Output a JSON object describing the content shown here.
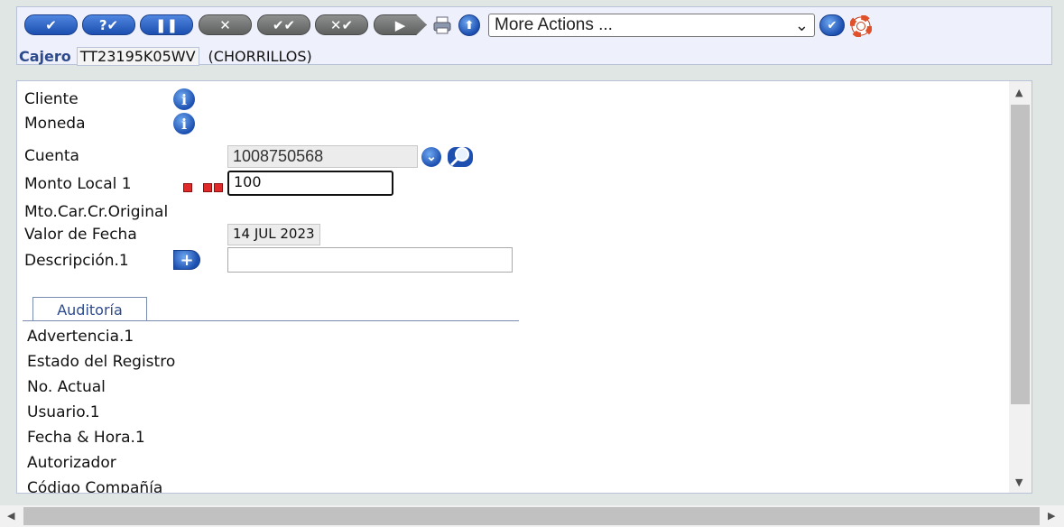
{
  "toolbar": {
    "buttons": [
      {
        "name": "commit-button",
        "glyph": "✔",
        "style": "blue"
      },
      {
        "name": "validate-button",
        "glyph": "?✔",
        "style": "blue"
      },
      {
        "name": "hold-button",
        "glyph": "❚❚",
        "style": "blue"
      },
      {
        "name": "delete-button",
        "glyph": "✕",
        "style": "gray"
      },
      {
        "name": "authorise-button",
        "glyph": "✔✔",
        "style": "gray"
      },
      {
        "name": "reverse-button",
        "glyph": "✕✔",
        "style": "gray"
      },
      {
        "name": "next-button",
        "glyph": "▶",
        "style": "gray"
      }
    ],
    "more_actions": "More Actions ...",
    "select_arrow": "⌄",
    "go_glyph": "✔",
    "upload_glyph": "⬆",
    "help_glyph": "◎"
  },
  "cajero": {
    "label": "Cajero",
    "id": "TT23195K05WV",
    "branch": "(CHORRILLOS)"
  },
  "form": {
    "cliente": "Cliente",
    "moneda": "Moneda",
    "cuenta": "Cuenta",
    "cuenta_value": "1008750568",
    "monto_local": "Monto Local 1",
    "monto_value": "100",
    "mto_car": "Mto.Car.Cr.Original",
    "valor_fecha": "Valor de Fecha",
    "valor_fecha_value": "14 JUL 2023",
    "descripcion": "Descripción.1",
    "info_glyph": "i",
    "dropdown_glyph": "⌄",
    "search_glyph": "⌕",
    "add_glyph": "+"
  },
  "tab": {
    "label": "Auditoría"
  },
  "audit": [
    "Advertencia.1",
    "Estado del Registro",
    "No. Actual",
    "Usuario.1",
    "Fecha & Hora.1",
    "Autorizador",
    "Código Compañía"
  ]
}
